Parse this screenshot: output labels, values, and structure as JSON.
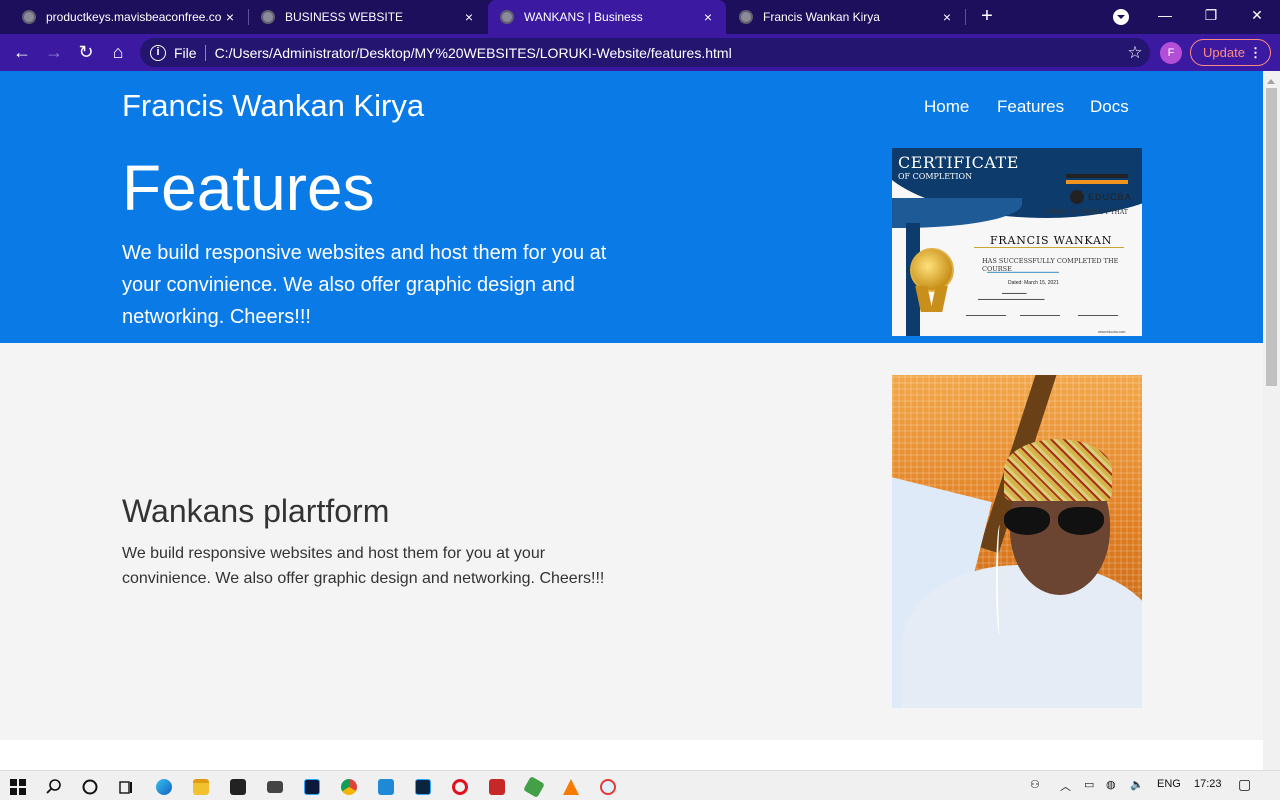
{
  "browser": {
    "tabs": [
      {
        "title": "productkeys.mavisbeaconfree.com",
        "active": false
      },
      {
        "title": "BUSINESS WEBSITE",
        "active": false
      },
      {
        "title": "WANKANS | Business",
        "active": true
      },
      {
        "title": "Francis Wankan Kirya",
        "active": false
      }
    ],
    "close_glyph": "×",
    "new_tab_glyph": "+",
    "window_controls": {
      "minimize": "—",
      "restore": "❐",
      "close": "✕"
    },
    "toolbar": {
      "back_glyph": "←",
      "forward_glyph": "→",
      "reload_glyph": "↻",
      "home_glyph": "⌂",
      "info_glyph": "i",
      "scheme_label": "File",
      "url": "C:/Users/Administrator/Desktop/MY%20WEBSITES/LORUKI-Website/features.html",
      "star_glyph": "☆",
      "profile_initial": "F",
      "update_label": "Update",
      "menu_glyph": "⋮"
    }
  },
  "page": {
    "brand": "Francis Wankan Kirya",
    "nav": [
      "Home",
      "Features",
      "Docs"
    ],
    "hero_title": "Features",
    "hero_lead": "We build responsive websites and host them for you at your convinience. We also offer graphic design and networking. Cheers!!!",
    "certificate": {
      "heading": "CERTIFICATE",
      "subheading": "OF COMPLETION",
      "org": "EDUCBA",
      "certify": "THIS IS TO CERTIFY THAT",
      "name": "FRANCIS WANKAN",
      "completed": "HAS SUCCESSFULLY COMPLETED THE COURSE",
      "date": "Dated: March 15, 2021",
      "website": "www.educba.com"
    },
    "section_title": "Wankans plartform",
    "section_text": "We build responsive websites and host them for you at your convinience. We also offer graphic design and networking. Cheers!!!"
  },
  "taskbar": {
    "lang": "ENG",
    "time": "17:23",
    "apps": [
      "start-icon",
      "search-icon",
      "cortana-icon",
      "task-view-icon",
      "edge-icon",
      "file-explorer-icon",
      "store-icon",
      "mail-icon",
      "photoshop-icon",
      "chrome-icon",
      "vscode-icon",
      "photoshop-2-icon",
      "opera-icon",
      "app-red-icon",
      "nodejs-icon",
      "vlc-icon",
      "app-paint-icon"
    ]
  },
  "colors": {
    "tabstrip": "#1d0f5c",
    "toolbar": "#3b1aa1",
    "hero": "#0a7ae6",
    "section": "#f4f4f4"
  }
}
